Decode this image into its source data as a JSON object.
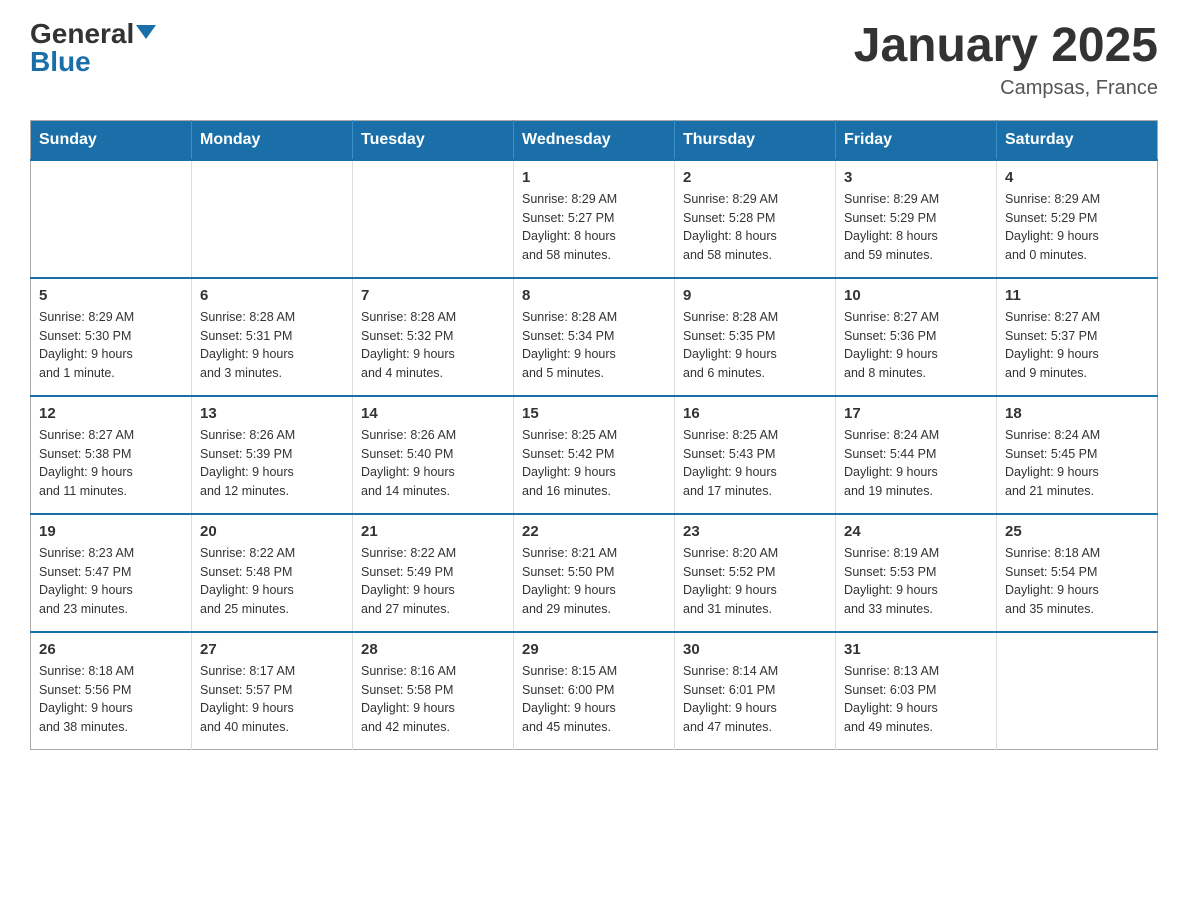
{
  "header": {
    "logo_general": "General",
    "logo_blue": "Blue",
    "month_title": "January 2025",
    "location": "Campsas, France"
  },
  "days_of_week": [
    "Sunday",
    "Monday",
    "Tuesday",
    "Wednesday",
    "Thursday",
    "Friday",
    "Saturday"
  ],
  "weeks": [
    [
      {
        "day": "",
        "info": ""
      },
      {
        "day": "",
        "info": ""
      },
      {
        "day": "",
        "info": ""
      },
      {
        "day": "1",
        "info": "Sunrise: 8:29 AM\nSunset: 5:27 PM\nDaylight: 8 hours\nand 58 minutes."
      },
      {
        "day": "2",
        "info": "Sunrise: 8:29 AM\nSunset: 5:28 PM\nDaylight: 8 hours\nand 58 minutes."
      },
      {
        "day": "3",
        "info": "Sunrise: 8:29 AM\nSunset: 5:29 PM\nDaylight: 8 hours\nand 59 minutes."
      },
      {
        "day": "4",
        "info": "Sunrise: 8:29 AM\nSunset: 5:29 PM\nDaylight: 9 hours\nand 0 minutes."
      }
    ],
    [
      {
        "day": "5",
        "info": "Sunrise: 8:29 AM\nSunset: 5:30 PM\nDaylight: 9 hours\nand 1 minute."
      },
      {
        "day": "6",
        "info": "Sunrise: 8:28 AM\nSunset: 5:31 PM\nDaylight: 9 hours\nand 3 minutes."
      },
      {
        "day": "7",
        "info": "Sunrise: 8:28 AM\nSunset: 5:32 PM\nDaylight: 9 hours\nand 4 minutes."
      },
      {
        "day": "8",
        "info": "Sunrise: 8:28 AM\nSunset: 5:34 PM\nDaylight: 9 hours\nand 5 minutes."
      },
      {
        "day": "9",
        "info": "Sunrise: 8:28 AM\nSunset: 5:35 PM\nDaylight: 9 hours\nand 6 minutes."
      },
      {
        "day": "10",
        "info": "Sunrise: 8:27 AM\nSunset: 5:36 PM\nDaylight: 9 hours\nand 8 minutes."
      },
      {
        "day": "11",
        "info": "Sunrise: 8:27 AM\nSunset: 5:37 PM\nDaylight: 9 hours\nand 9 minutes."
      }
    ],
    [
      {
        "day": "12",
        "info": "Sunrise: 8:27 AM\nSunset: 5:38 PM\nDaylight: 9 hours\nand 11 minutes."
      },
      {
        "day": "13",
        "info": "Sunrise: 8:26 AM\nSunset: 5:39 PM\nDaylight: 9 hours\nand 12 minutes."
      },
      {
        "day": "14",
        "info": "Sunrise: 8:26 AM\nSunset: 5:40 PM\nDaylight: 9 hours\nand 14 minutes."
      },
      {
        "day": "15",
        "info": "Sunrise: 8:25 AM\nSunset: 5:42 PM\nDaylight: 9 hours\nand 16 minutes."
      },
      {
        "day": "16",
        "info": "Sunrise: 8:25 AM\nSunset: 5:43 PM\nDaylight: 9 hours\nand 17 minutes."
      },
      {
        "day": "17",
        "info": "Sunrise: 8:24 AM\nSunset: 5:44 PM\nDaylight: 9 hours\nand 19 minutes."
      },
      {
        "day": "18",
        "info": "Sunrise: 8:24 AM\nSunset: 5:45 PM\nDaylight: 9 hours\nand 21 minutes."
      }
    ],
    [
      {
        "day": "19",
        "info": "Sunrise: 8:23 AM\nSunset: 5:47 PM\nDaylight: 9 hours\nand 23 minutes."
      },
      {
        "day": "20",
        "info": "Sunrise: 8:22 AM\nSunset: 5:48 PM\nDaylight: 9 hours\nand 25 minutes."
      },
      {
        "day": "21",
        "info": "Sunrise: 8:22 AM\nSunset: 5:49 PM\nDaylight: 9 hours\nand 27 minutes."
      },
      {
        "day": "22",
        "info": "Sunrise: 8:21 AM\nSunset: 5:50 PM\nDaylight: 9 hours\nand 29 minutes."
      },
      {
        "day": "23",
        "info": "Sunrise: 8:20 AM\nSunset: 5:52 PM\nDaylight: 9 hours\nand 31 minutes."
      },
      {
        "day": "24",
        "info": "Sunrise: 8:19 AM\nSunset: 5:53 PM\nDaylight: 9 hours\nand 33 minutes."
      },
      {
        "day": "25",
        "info": "Sunrise: 8:18 AM\nSunset: 5:54 PM\nDaylight: 9 hours\nand 35 minutes."
      }
    ],
    [
      {
        "day": "26",
        "info": "Sunrise: 8:18 AM\nSunset: 5:56 PM\nDaylight: 9 hours\nand 38 minutes."
      },
      {
        "day": "27",
        "info": "Sunrise: 8:17 AM\nSunset: 5:57 PM\nDaylight: 9 hours\nand 40 minutes."
      },
      {
        "day": "28",
        "info": "Sunrise: 8:16 AM\nSunset: 5:58 PM\nDaylight: 9 hours\nand 42 minutes."
      },
      {
        "day": "29",
        "info": "Sunrise: 8:15 AM\nSunset: 6:00 PM\nDaylight: 9 hours\nand 45 minutes."
      },
      {
        "day": "30",
        "info": "Sunrise: 8:14 AM\nSunset: 6:01 PM\nDaylight: 9 hours\nand 47 minutes."
      },
      {
        "day": "31",
        "info": "Sunrise: 8:13 AM\nSunset: 6:03 PM\nDaylight: 9 hours\nand 49 minutes."
      },
      {
        "day": "",
        "info": ""
      }
    ]
  ]
}
